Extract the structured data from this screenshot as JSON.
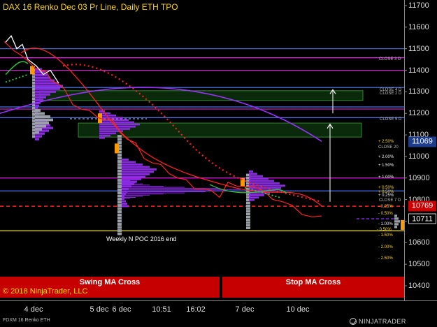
{
  "chart_title": "DAX 16 Renko Dec 03 Pr Line, Daily ETH TPO",
  "y_axis_ticks": [
    "11700",
    "11600",
    "11500",
    "11400",
    "11300",
    "11200",
    "11100",
    "11000",
    "10900",
    "10800",
    "10700",
    "10600",
    "10500",
    "10400"
  ],
  "x_axis_ticks": [
    "4 dec",
    "5 dec",
    "6 dec",
    "10:51",
    "16:02",
    "7 dec",
    "10 dec"
  ],
  "price_tags": [
    {
      "label": "11069",
      "value": 11069,
      "bg": "#1e3c8c",
      "fg": "#ffffff"
    },
    {
      "label": "10769",
      "value": 10769,
      "bg": "#cc0000",
      "fg": "#ffffff"
    },
    {
      "label": "10711",
      "value": 10711,
      "bg": "#000000",
      "fg": "#ffffff"
    }
  ],
  "close_labels": [
    "CLOSE 3 D",
    "CLOSE 4 D",
    "CLOSE 2 D",
    "CLOSE 5 D",
    "CLOSE 20",
    "CLOSE 7 D"
  ],
  "percent_labels": [
    "+ 2.50%",
    "+ 2.00%",
    "+ 1.50%",
    "+ 1.00%",
    "+ 0.50%",
    "+ 0.25%",
    "- 0.25%",
    "- 0.50%",
    "- 1.00%",
    "- 1.50%",
    "- 2.00%",
    "- 2.50%",
    "+ 0.50%",
    "- 0.50%"
  ],
  "poc_label": "Weekly N POC 2016 end",
  "panels": {
    "left": "Swing MA Cross",
    "right": "Stop MA Cross"
  },
  "copyright": "© 2018 NinjaTrader, LLC",
  "footer_instrument": "FDXM 16 Renko ETH",
  "brand": "NINJATRADER",
  "colors": {
    "background": "#000000",
    "price_line": "#ff2020",
    "ma_purple": "#9b30ff",
    "ma_green": "#2fbf3f",
    "tpo_purple": "#8a2be2",
    "tpo_gray": "#9aa0a8",
    "level_magenta": "#e020e0",
    "level_blue": "#4a6fe0",
    "zone_green": "#2e8b2e",
    "panel_red": "#c60000",
    "title_gold": "#ffd700"
  },
  "chart_data": {
    "type": "line",
    "title": "DAX 16 Renko Dec 03 Pr Line, Daily ETH TPO",
    "ylim": [
      10350,
      11720
    ],
    "ylabel": "",
    "x_categories": [
      "4 dec",
      "5 dec",
      "6 dec",
      "10:51",
      "16:02",
      "7 dec",
      "10 dec"
    ],
    "series": [
      {
        "values": [
          11520,
          11480,
          11440,
          11420,
          11380,
          11360,
          11320,
          11300,
          11260,
          11220,
          11200,
          11180,
          11150,
          11120,
          11080,
          11040,
          11000,
          10960,
          10930,
          10900,
          10880,
          10860,
          10840,
          10820,
          10810,
          10800,
          10790,
          10780,
          10770,
          10760,
          10740,
          10720,
          10710,
          10700,
          10711
        ]
      }
    ],
    "levels": [
      {
        "value": 11500,
        "color": "blue"
      },
      {
        "value": 11458,
        "color": "magenta"
      },
      {
        "value": 11400,
        "color": "magenta"
      },
      {
        "value": 11320,
        "color": "blue"
      },
      {
        "value": 11230,
        "color": "blue"
      },
      {
        "value": 11220,
        "color": "magenta"
      },
      {
        "value": 11180,
        "color": "blue"
      },
      {
        "value": 10900,
        "color": "magenta"
      },
      {
        "value": 10840,
        "color": "blue"
      },
      {
        "value": 10655,
        "color": "yellow"
      }
    ],
    "zones": [
      {
        "from": 11305,
        "to": 11260
      },
      {
        "from": 11155,
        "to": 11090
      }
    ],
    "grid": false
  }
}
